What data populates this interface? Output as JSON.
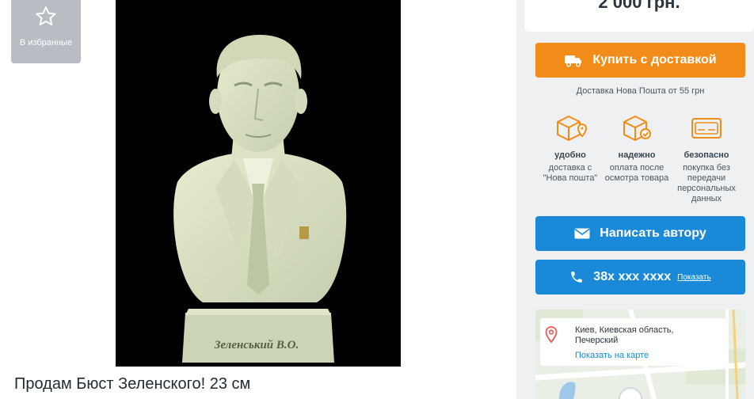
{
  "favorite": {
    "label": "В избранные",
    "icon": "star-icon"
  },
  "listing": {
    "title": "Продам Бюст Зеленского! 23 см"
  },
  "photo": {
    "plaque_text": "Зеленський В.О."
  },
  "sidebar": {
    "price": "2 000 грн.",
    "buy_button": "Купить с доставкой",
    "delivery_note": "Доставка Нова Пошта от 55 грн",
    "features": [
      {
        "icon": "box-location-icon",
        "title": "удобно",
        "desc": "доставка с \"Нова пошта\""
      },
      {
        "icon": "box-check-icon",
        "title": "надежно",
        "desc": "оплата после осмотра товара"
      },
      {
        "icon": "card-icon",
        "title": "безопасно",
        "desc": "покупка без передачи персональных данных"
      }
    ],
    "write_button": "Написать автору",
    "phone": "38х ххх хххх",
    "show_link": "Показать",
    "location": {
      "city": "Киев, Киевская область,",
      "district": "Печерский",
      "map_link": "Показать на карте"
    }
  },
  "colors": {
    "accent_orange": "#f28c18",
    "accent_blue": "#1a8ad8",
    "text_dark": "#1f2a33"
  }
}
